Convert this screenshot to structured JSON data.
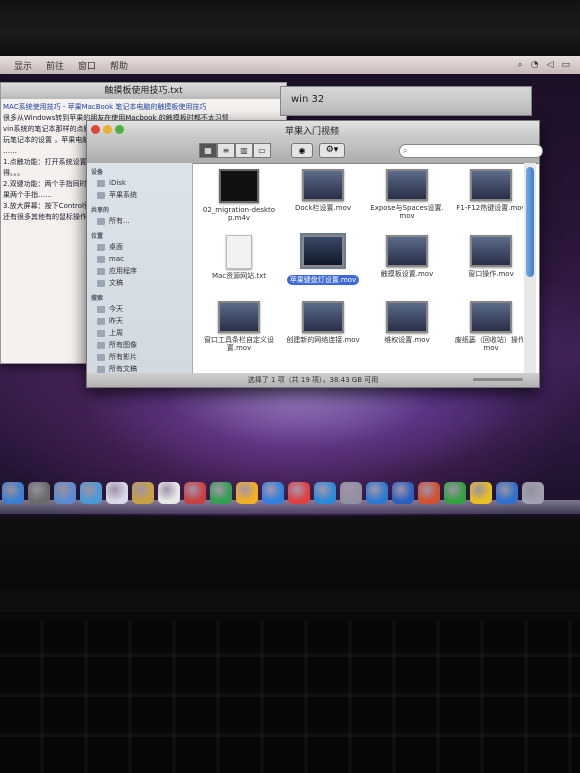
{
  "menubar": {
    "items": [
      "显示",
      "前往",
      "窗口",
      "帮助"
    ]
  },
  "textwindow": {
    "title": "触摸板使用技巧.txt",
    "lines": [
      "MAC系统使用技巧 - 苹果MacBook 笔记本电脑的触摸板使用技巧",
      "很多从Windows转到苹果的朋友在使用Macbook 的触摸板时都不太习惯",
      "vin系统的笔记本那样的点触方式，苹果笔记本的触控板……",
      "玩笔记本的设置 ，苹果电脑……",
      "……",
      "1.点触功能：打开系统设置——",
      "得。。。",
      "",
      "2.双键功能：两个手指同时点击",
      "  果两个手指……",
      "",
      "3.放大屏幕：按下Control键",
      "",
      "还有很多其他有的鼠标操作都"
    ]
  },
  "win32": {
    "title": "win 32"
  },
  "finder": {
    "title": "苹果入门视频",
    "search_placeholder": "",
    "sidebar": [
      {
        "group": "设备",
        "items": [
          "iDisk",
          "苹果系统"
        ]
      },
      {
        "group": "共享的",
        "items": [
          "所有..."
        ]
      },
      {
        "group": "位置",
        "items": [
          "桌面",
          "mac",
          "应用程序",
          "文稿"
        ]
      },
      {
        "group": "搜索",
        "items": [
          "今天",
          "昨天",
          "上周",
          "所有图像",
          "所有影片",
          "所有文稿"
        ]
      }
    ],
    "files": [
      {
        "name": "02_migration-desktop.m4v",
        "kind": "dark"
      },
      {
        "name": "Dock栏设置.mov",
        "kind": "video"
      },
      {
        "name": "Expose与Spaces设置.mov",
        "kind": "video"
      },
      {
        "name": "F1-F12热键设置.mov",
        "kind": "video"
      },
      {
        "name": "Mac资源网站.txt",
        "kind": "doc"
      },
      {
        "name": "苹果键盘灯设置.mov",
        "kind": "sel"
      },
      {
        "name": "触摸板设置.mov",
        "kind": "video"
      },
      {
        "name": "窗口操作.mov",
        "kind": "video"
      },
      {
        "name": "窗口工具条栏自定义设置.mov",
        "kind": "video"
      },
      {
        "name": "创建新的网络连接.mov",
        "kind": "video"
      },
      {
        "name": "维权设置.mov",
        "kind": "video"
      },
      {
        "name": "废纸篓（回收站）操作.mov",
        "kind": "video"
      }
    ],
    "status": "选择了 1 项（共 19 项），38.43 GB 可用"
  },
  "dock_colors": [
    "#3b7fd0",
    "#6a6a6a",
    "#5a8ad0",
    "#4a9ad8",
    "#d8d8e8",
    "#c9a040",
    "#e8e8e8",
    "#c84040",
    "#30a050",
    "#f0b020",
    "#3080e0",
    "#e04040",
    "#2a8ad8",
    "#9090a0",
    "#2a7ad0",
    "#2a60c0",
    "#d05030",
    "#30a040",
    "#e8c020",
    "#3070d0",
    "#a0a0b0"
  ]
}
